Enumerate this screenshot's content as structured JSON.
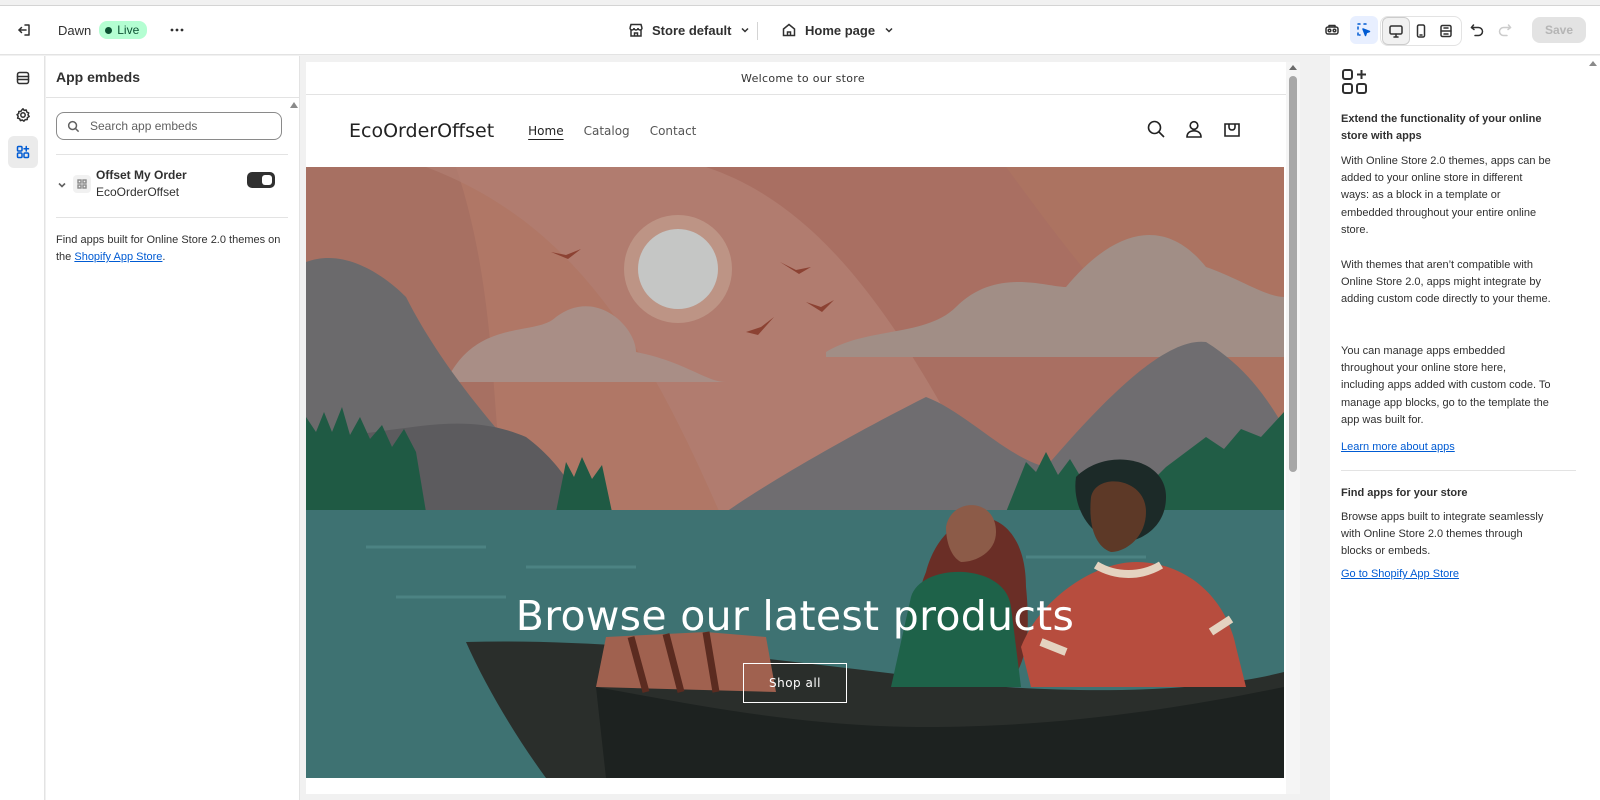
{
  "topbar": {
    "theme_name": "Dawn",
    "status_badge": "Live",
    "store_selector": "Store default",
    "page_selector": "Home page",
    "save_label": "Save"
  },
  "left_panel": {
    "title": "App embeds",
    "search_placeholder": "Search app embeds",
    "embed": {
      "name": "Offset My Order",
      "app": "EcoOrderOffset",
      "enabled": true
    },
    "find_text": "Find apps built for Online Store 2.0 themes on the ",
    "find_link": "Shopify App Store",
    "find_end": "."
  },
  "preview": {
    "announcement": "Welcome to our store",
    "logo": "EcoOrderOffset",
    "nav": [
      "Home",
      "Catalog",
      "Contact"
    ],
    "hero_title": "Browse our latest products",
    "hero_button": "Shop all"
  },
  "right_panel": {
    "heading": "Extend the functionality of your online store with apps",
    "para1": "With Online Store 2.0 themes, apps can be added to your online store in different ways: as a block in a template or embedded throughout your entire online store.",
    "para2": "With themes that aren’t compatible with Online Store 2.0, apps might integrate by adding custom code directly to your theme.",
    "para3": "You can manage apps embedded throughout your online store here, including apps added with custom code. To manage app blocks, go to the template the app was built for.",
    "learn_link": "Learn more about apps",
    "heading2": "Find apps for your store",
    "para4": "Browse apps built to integrate seamlessly with Online Store 2.0 themes through blocks or embeds.",
    "store_link": "Go to Shopify App Store"
  }
}
